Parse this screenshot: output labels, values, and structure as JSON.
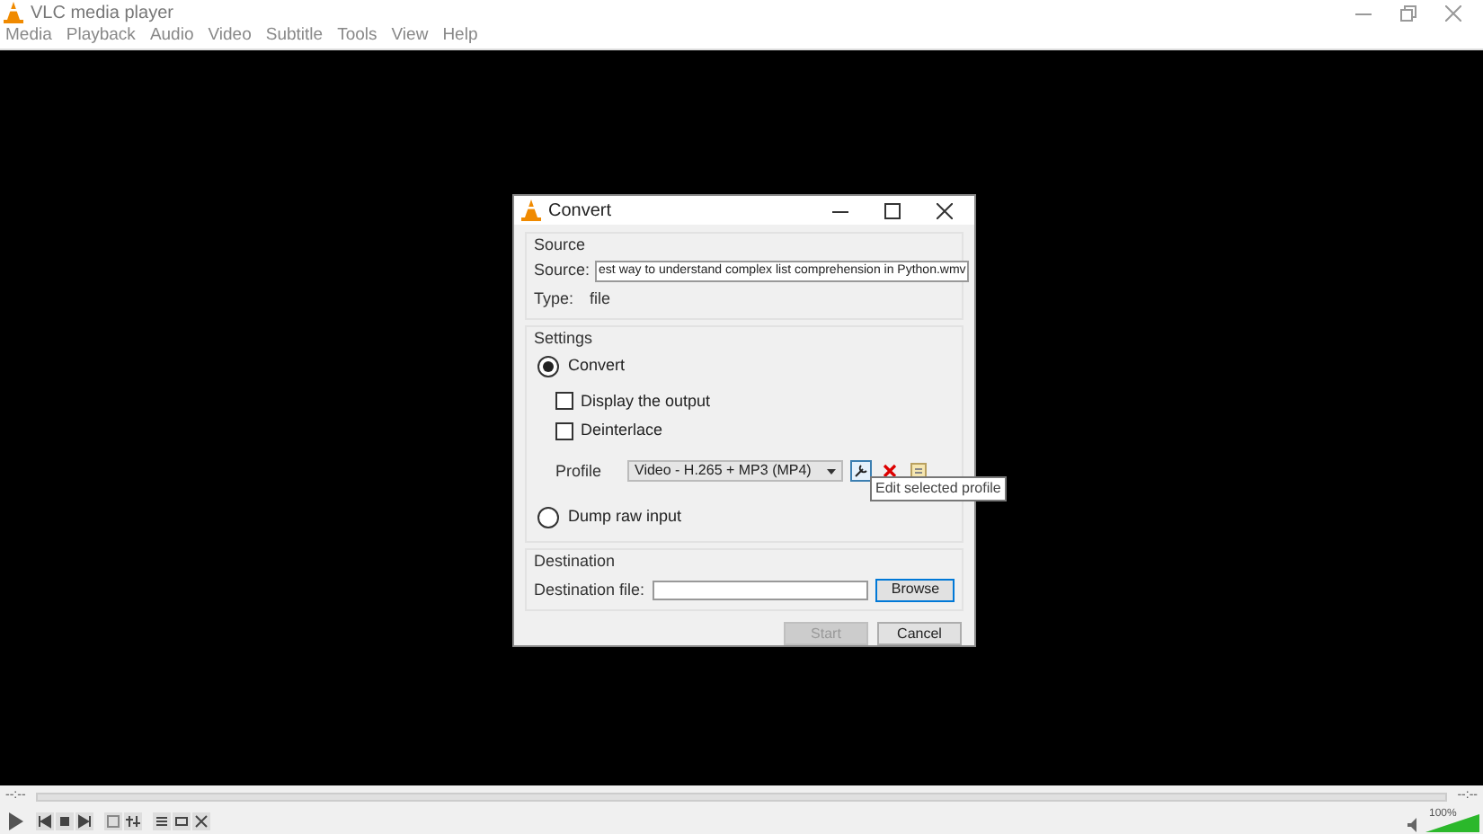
{
  "window": {
    "title": "VLC media player"
  },
  "menu": [
    "Media",
    "Playback",
    "Audio",
    "Video",
    "Subtitle",
    "Tools",
    "View",
    "Help"
  ],
  "dialog": {
    "title": "Convert",
    "source_group": {
      "title": "Source",
      "source_label": "Source:",
      "source_value": "est way to understand complex list comprehension in Python.wmv",
      "type_label": "Type:",
      "type_value": "file"
    },
    "settings_group": {
      "title": "Settings",
      "convert": {
        "label": "Convert",
        "selected": true
      },
      "checkboxes": [
        {
          "label": "Display the output",
          "checked": false
        },
        {
          "label": "Deinterlace",
          "checked": false
        }
      ],
      "profile_label": "Profile",
      "profile_value": "Video - H.265 + MP3 (MP4)",
      "tooltip": "Edit selected profile",
      "dump": {
        "label": "Dump raw input",
        "selected": false
      }
    },
    "destination_group": {
      "title": "Destination",
      "file_label": "Destination file:",
      "browse": "Browse"
    },
    "buttons": [
      {
        "label": "Start",
        "disabled": true
      },
      {
        "label": "Cancel",
        "disabled": false
      }
    ]
  },
  "player": {
    "elapsed": "--:--",
    "remaining": "--:--",
    "volume": {
      "reading": "100%",
      "level": 1
    }
  }
}
